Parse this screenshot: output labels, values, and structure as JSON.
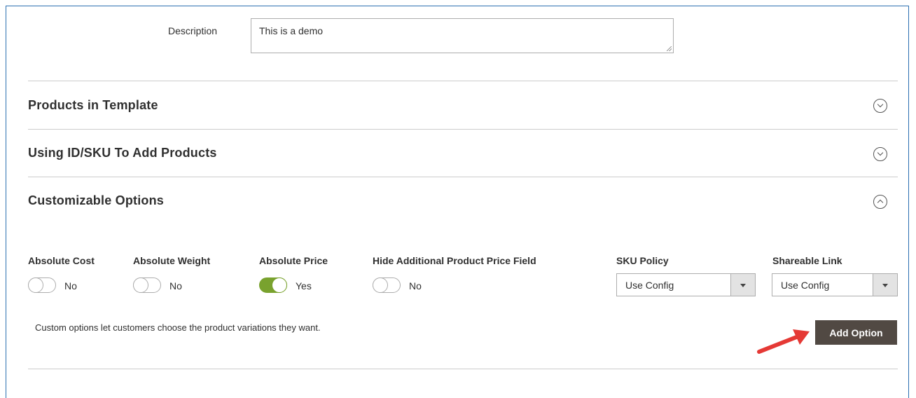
{
  "description": {
    "label": "Description",
    "value": "This is a demo"
  },
  "sections": [
    {
      "title": "Products in Template",
      "state": "collapsed"
    },
    {
      "title": "Using ID/SKU To Add Products",
      "state": "collapsed"
    },
    {
      "title": "Customizable Options",
      "state": "expanded"
    }
  ],
  "options": {
    "toggles": [
      {
        "label": "Absolute Cost",
        "value": "No",
        "on": false
      },
      {
        "label": "Absolute Weight",
        "value": "No",
        "on": false
      },
      {
        "label": "Absolute Price",
        "value": "Yes",
        "on": true
      },
      {
        "label": "Hide Additional Product Price Field",
        "value": "No",
        "on": false
      }
    ],
    "selects": [
      {
        "label": "SKU Policy",
        "value": "Use Config"
      },
      {
        "label": "Shareable Link",
        "value": "Use Config"
      }
    ],
    "note": "Custom options let customers choose the product variations they want.",
    "add_button_label": "Add Option"
  },
  "colors": {
    "frame_border": "#2a6fb0",
    "toggle_on": "#79a22e",
    "button_bg": "#514943",
    "annotation_arrow": "#e53935"
  }
}
